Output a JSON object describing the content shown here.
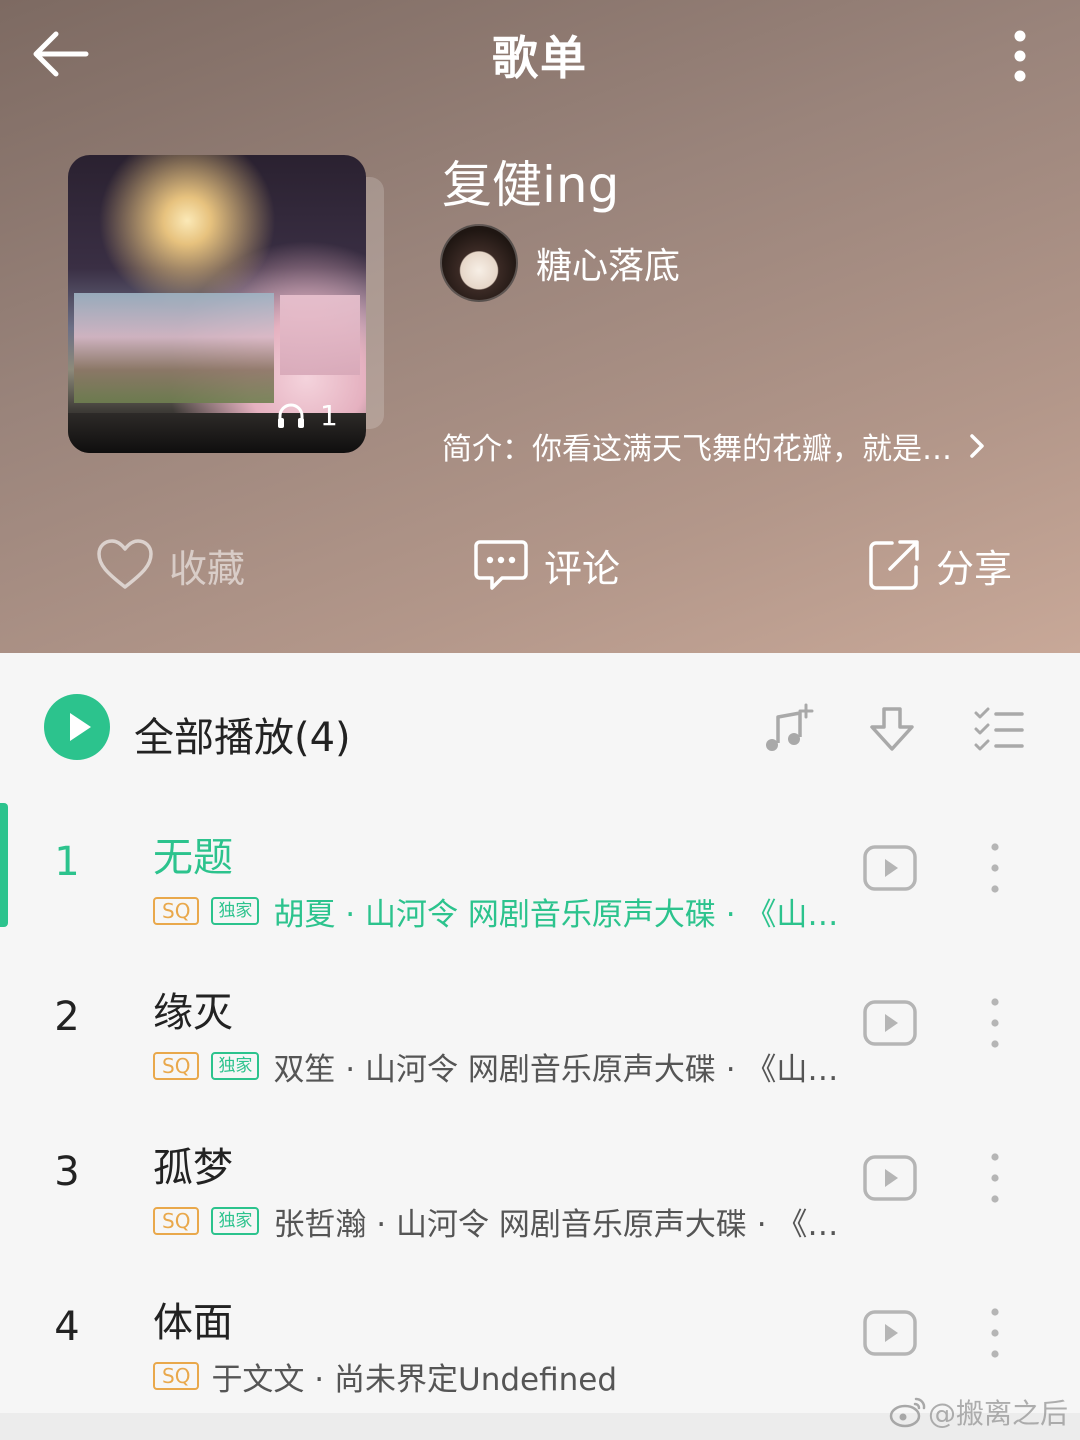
{
  "topbar": {
    "title": "歌单"
  },
  "playlist": {
    "name": "复健ing",
    "play_count": "1",
    "creator": "糖心落底",
    "intro": "简介：你看这满天飞舞的花瓣，就是…"
  },
  "actions": {
    "favorite_label": "收藏",
    "comment_label": "评论",
    "share_label": "分享"
  },
  "list_header": {
    "play_all_label": "全部播放(4)"
  },
  "songs": [
    {
      "index": "1",
      "title": "无题",
      "sq": "SQ",
      "exclusive": "独家",
      "meta": "胡夏 · 山河令 网剧音乐原声大碟 · 《山…",
      "active": true
    },
    {
      "index": "2",
      "title": "缘灭",
      "sq": "SQ",
      "exclusive": "独家",
      "meta": "双笙 · 山河令 网剧音乐原声大碟 · 《山…",
      "active": false
    },
    {
      "index": "3",
      "title": "孤梦",
      "sq": "SQ",
      "exclusive": "独家",
      "meta": "张哲瀚 · 山河令 网剧音乐原声大碟 · 《…",
      "active": false
    },
    {
      "index": "4",
      "title": "体面",
      "sq": "SQ",
      "exclusive": "",
      "meta": "于文文 · 尚未界定Undefined",
      "active": false
    }
  ],
  "watermark": "@搬离之后",
  "colors": {
    "accent": "#2cc38d",
    "sq_tag": "#e9a84b"
  }
}
